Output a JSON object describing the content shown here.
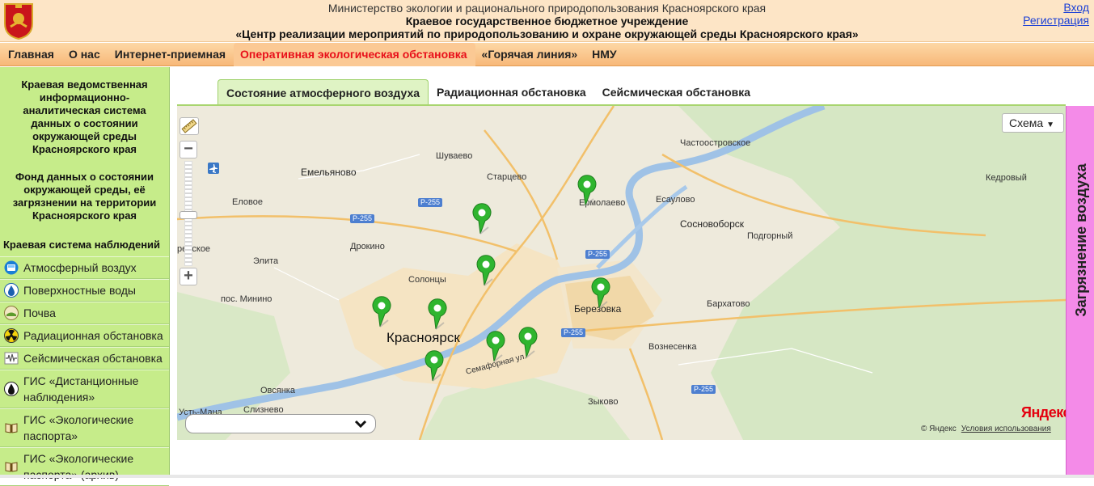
{
  "header": {
    "line1": "Министерство экологии и рационального природопользования Красноярского края",
    "line2": "Краевое государственное бюджетное учреждение",
    "line3": "«Центр реализации мероприятий по природопользованию и охране окружающей среды Красноярского края»",
    "login": "Вход",
    "register": "Регистрация"
  },
  "menu": [
    "Главная",
    "О нас",
    "Интернет-приемная",
    "Оперативная экологическая обстановка",
    "«Горячая линия»",
    "НМУ"
  ],
  "menu_active_index": 3,
  "sidebar": {
    "block1": "Краевая ведомственная информационно-аналитическая система данных о состоянии окружающей среды Красноярского края",
    "block2": "Фонд данных о состоянии окружающей среды, её загрязнении на территории Красноярского края",
    "section_title": "Краевая система наблюдений",
    "items": [
      {
        "label": "Атмосферный воздух",
        "icon": "air-icon"
      },
      {
        "label": "Поверхностные воды",
        "icon": "water-drop-icon"
      },
      {
        "label": "Почва",
        "icon": "soil-icon"
      },
      {
        "label": "Радиационная обстановка",
        "icon": "radiation-icon"
      },
      {
        "label": "Сейсмическая обстановка",
        "icon": "seismic-icon"
      },
      {
        "label": "ГИС «Дистанционные наблюдения»",
        "icon": "oil-drop-icon"
      },
      {
        "label": "ГИС «Экологические паспорта»",
        "icon": "book-icon"
      },
      {
        "label": "ГИС «Экологические паспорта» (архив)",
        "icon": "book-icon"
      }
    ]
  },
  "tabs": [
    "Состояние атмосферного воздуха",
    "Радиационная обстановка",
    "Сейсмическая обстановка"
  ],
  "tabs_active_index": 0,
  "map": {
    "scheme_label": "Схема",
    "city": "Красноярск",
    "places": {
      "emelyanovo": "Емельяново",
      "shuvaevo": "Шуваево",
      "startsevo": "Старцево",
      "chastoostrovskoe": "Частоостровское",
      "kedrovy": "Кедровый",
      "eloevoe": "Еловое",
      "ermolaevo": "Ермолаево",
      "esaulovo": "Есаулово",
      "sosnovoborsk": "Сосновоборск",
      "podgorny": "Подгорный",
      "drokino": "Дрокино",
      "elita": "Элита",
      "skoe": "рейское",
      "solontsy": "Солонцы",
      "minino": "пос. Минино",
      "berezovka": "Березовка",
      "barkhatovo": "Бархатово",
      "voznesenka": "Вознесенка",
      "semafornaya": "Семафорная ул.",
      "ovsyanka": "Овсянка",
      "zykovo": "Зыково",
      "ustmana": "Усть-Мана",
      "sliznevo": "Слизнево"
    },
    "roads": [
      "Р-255",
      "Р-255",
      "Р-255",
      "Р-255",
      "Р-255"
    ],
    "logo": "Яндекс",
    "copyright": "© Яндекс",
    "terms": "Условия использования"
  },
  "side_panel": {
    "label": "Загрязнение воздуха"
  },
  "colors": {
    "header_bg": "#fde5c6",
    "menu_bg": "#f7b879",
    "menu_active": "#e8101a",
    "sidebar_bg": "#c6ec8a",
    "side_panel_bg": "#f48be8",
    "pin": "#2fb52f"
  }
}
